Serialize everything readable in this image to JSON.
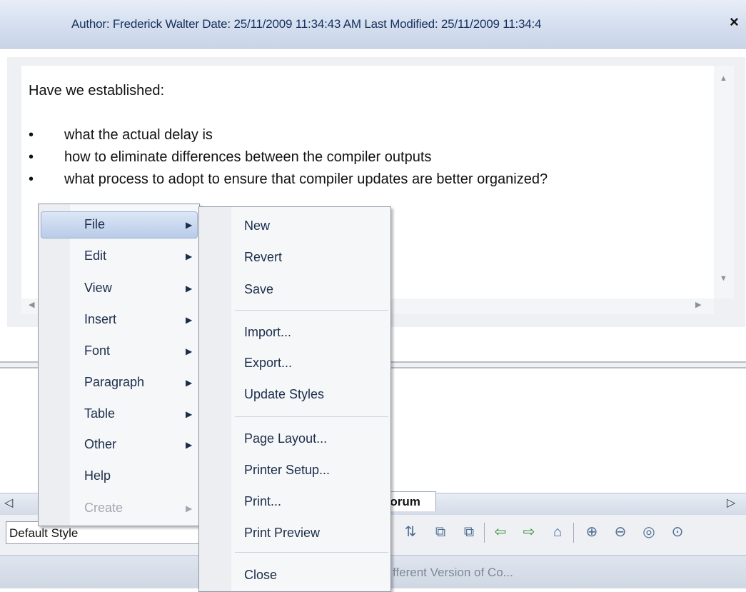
{
  "header": {
    "text": "Author: Frederick Walter   Date: 25/11/2009 11:34:43 AM   Last Modified: 25/11/2009 11:34:4",
    "close_glyph": "×"
  },
  "editor": {
    "intro": "Have we established:",
    "bullets": [
      "what the actual delay is",
      "how to eliminate differences between the compiler outputs",
      "what process to adopt to ensure that compiler updates are better organized?"
    ]
  },
  "context_menu": {
    "items": [
      {
        "label": "File",
        "submenu": true,
        "highlighted": true
      },
      {
        "label": "Edit",
        "submenu": true
      },
      {
        "label": "View",
        "submenu": true
      },
      {
        "label": "Insert",
        "submenu": true
      },
      {
        "label": "Font",
        "submenu": true
      },
      {
        "label": "Paragraph",
        "submenu": true
      },
      {
        "label": "Table",
        "submenu": true
      },
      {
        "label": "Other",
        "submenu": true
      },
      {
        "label": "Help",
        "submenu": false
      },
      {
        "label": "Create",
        "submenu": true,
        "disabled": true
      }
    ]
  },
  "file_submenu": {
    "items": [
      "New",
      "Revert",
      "Save",
      "Import...",
      "Export...",
      "Update Styles",
      "Page Layout...",
      "Printer Setup...",
      "Print...",
      "Print Preview",
      "Close"
    ]
  },
  "tabs": {
    "active_label": "Forum",
    "left_arrow": "◁",
    "right_arrow": "▷"
  },
  "toolbar": {
    "style_value": "Default Style",
    "icons": [
      "sort-icon",
      "copy-format-icon",
      "paste-format-icon",
      "back-icon",
      "forward-icon",
      "home-icon",
      "zoom-in-icon",
      "zoom-out-icon",
      "zoom-fit-icon",
      "zoom-page-icon"
    ]
  },
  "status": {
    "text": "fferent Version of Co..."
  }
}
